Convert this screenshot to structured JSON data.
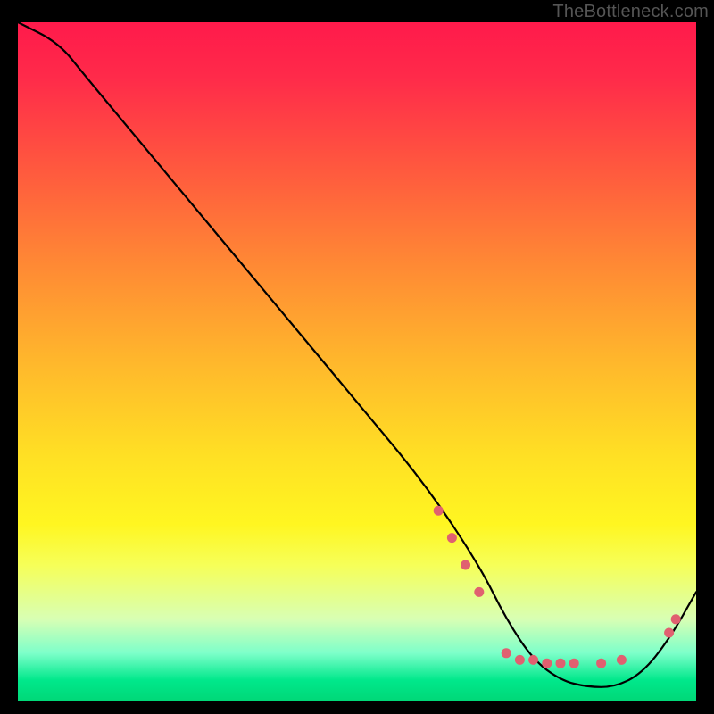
{
  "watermark": "TheBottleneck.com",
  "chart_data": {
    "type": "line",
    "title": "",
    "xlabel": "",
    "ylabel": "",
    "xlim": [
      0,
      100
    ],
    "ylim": [
      0,
      100
    ],
    "grid": false,
    "series": [
      {
        "name": "curve",
        "x": [
          0,
          6,
          10,
          20,
          30,
          40,
          50,
          60,
          68,
          72,
          76,
          80,
          84,
          88,
          92,
          96,
          100
        ],
        "values": [
          100,
          97,
          92,
          80,
          68,
          56,
          44,
          32,
          20,
          12,
          6,
          3,
          2,
          2,
          4,
          9,
          16
        ]
      }
    ],
    "highlight_points": [
      {
        "x": 62,
        "y": 28
      },
      {
        "x": 64,
        "y": 24
      },
      {
        "x": 66,
        "y": 20
      },
      {
        "x": 68,
        "y": 16
      },
      {
        "x": 72,
        "y": 7
      },
      {
        "x": 74,
        "y": 6
      },
      {
        "x": 76,
        "y": 6
      },
      {
        "x": 78,
        "y": 5.5
      },
      {
        "x": 80,
        "y": 5.5
      },
      {
        "x": 82,
        "y": 5.5
      },
      {
        "x": 86,
        "y": 5.5
      },
      {
        "x": 89,
        "y": 6
      },
      {
        "x": 96,
        "y": 10
      },
      {
        "x": 97,
        "y": 12
      }
    ],
    "gradient_stops": [
      {
        "pos": 0,
        "color": "#ff1a4b"
      },
      {
        "pos": 22,
        "color": "#ff5a3e"
      },
      {
        "pos": 50,
        "color": "#ffb72c"
      },
      {
        "pos": 74,
        "color": "#fff621"
      },
      {
        "pos": 93,
        "color": "#7dffca"
      },
      {
        "pos": 100,
        "color": "#00d878"
      }
    ]
  }
}
